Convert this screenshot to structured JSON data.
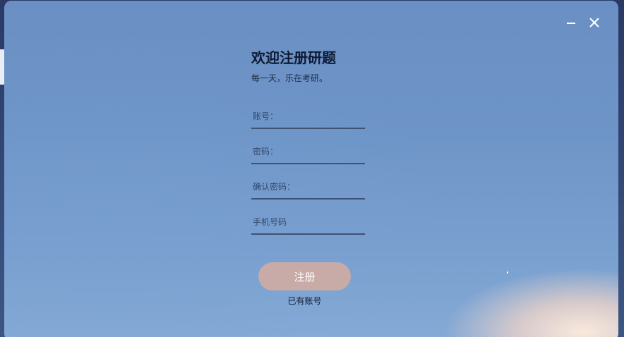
{
  "window": {
    "minimize_icon": "minimize-icon",
    "close_icon": "close-icon"
  },
  "form": {
    "title": "欢迎注册研题",
    "subtitle": "每一天，乐在考研。",
    "fields": [
      {
        "placeholder": "账号：",
        "value": ""
      },
      {
        "placeholder": "密码：",
        "value": ""
      },
      {
        "placeholder": "确认密码：",
        "value": ""
      },
      {
        "placeholder": "手机号码",
        "value": ""
      }
    ],
    "submit_label": "注册",
    "login_link": "已有账号"
  },
  "colors": {
    "button_bg": "#c8aaa6",
    "underline": "#3f5272",
    "title": "#0d1a33"
  }
}
